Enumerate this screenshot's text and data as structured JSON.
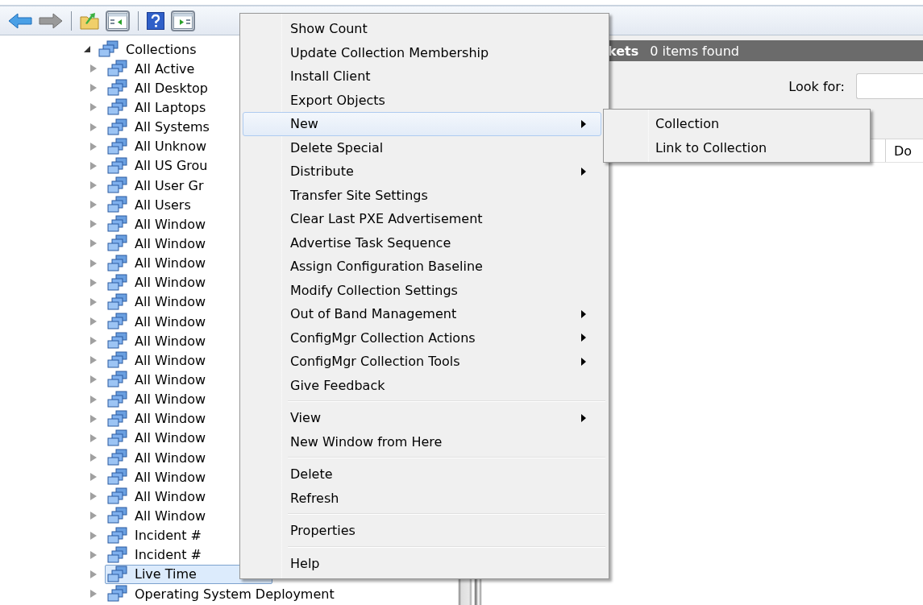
{
  "toolbar": [
    {
      "kind": "back"
    },
    {
      "kind": "forward"
    },
    {
      "kind": "separator"
    },
    {
      "kind": "up"
    },
    {
      "kind": "tree-toggle"
    },
    {
      "kind": "separator"
    },
    {
      "kind": "help"
    },
    {
      "kind": "action-toggle"
    }
  ],
  "tree": {
    "label": "Collections",
    "expanded": true,
    "children": [
      {
        "label": "All Active",
        "selected": false
      },
      {
        "label": "All Desktop",
        "selected": false
      },
      {
        "label": "All Laptops",
        "selected": false
      },
      {
        "label": "All Systems",
        "selected": false
      },
      {
        "label": "All Unknow",
        "selected": false
      },
      {
        "label": "All US Grou",
        "selected": false
      },
      {
        "label": "All User Gr",
        "selected": false
      },
      {
        "label": "All Users",
        "selected": false
      },
      {
        "label": "All Window",
        "selected": false
      },
      {
        "label": "All Window",
        "selected": false
      },
      {
        "label": "All Window",
        "selected": false
      },
      {
        "label": "All Window",
        "selected": false
      },
      {
        "label": "All Window",
        "selected": false
      },
      {
        "label": "All Window",
        "selected": false
      },
      {
        "label": "All Window",
        "selected": false
      },
      {
        "label": "All Window",
        "selected": false
      },
      {
        "label": "All Window",
        "selected": false
      },
      {
        "label": "All Window",
        "selected": false
      },
      {
        "label": "All Window",
        "selected": false
      },
      {
        "label": "All Window",
        "selected": false
      },
      {
        "label": "All Window",
        "selected": false
      },
      {
        "label": "All Window",
        "selected": false
      },
      {
        "label": "All Window",
        "selected": false
      },
      {
        "label": "All Window",
        "selected": false
      },
      {
        "label": "Incident #",
        "selected": false
      },
      {
        "label": "Incident #",
        "selected": false
      },
      {
        "label": "Live Time",
        "selected": true
      },
      {
        "label": "Operating System Deployment",
        "selected": false
      }
    ]
  },
  "results": {
    "title": "kets",
    "count": "0 items found",
    "search_label": "Look for:",
    "column_1": "Do"
  },
  "context_menu": [
    {
      "kind": "item",
      "label": "Show Count",
      "submenu": false,
      "selected": false
    },
    {
      "kind": "item",
      "label": "Update Collection Membership",
      "submenu": false,
      "selected": false
    },
    {
      "kind": "item",
      "label": "Install Client",
      "submenu": false,
      "selected": false
    },
    {
      "kind": "item",
      "label": "Export Objects",
      "submenu": false,
      "selected": false
    },
    {
      "kind": "item",
      "label": "New",
      "submenu": true,
      "selected": true
    },
    {
      "kind": "item",
      "label": "Delete Special",
      "submenu": false,
      "selected": false
    },
    {
      "kind": "item",
      "label": "Distribute",
      "submenu": true,
      "selected": false
    },
    {
      "kind": "item",
      "label": "Transfer Site Settings",
      "submenu": false,
      "selected": false
    },
    {
      "kind": "item",
      "label": "Clear Last PXE Advertisement",
      "submenu": false,
      "selected": false
    },
    {
      "kind": "item",
      "label": "Advertise Task Sequence",
      "submenu": false,
      "selected": false
    },
    {
      "kind": "item",
      "label": "Assign Configuration Baseline",
      "submenu": false,
      "selected": false
    },
    {
      "kind": "item",
      "label": "Modify Collection Settings",
      "submenu": false,
      "selected": false
    },
    {
      "kind": "item",
      "label": "Out of Band Management",
      "submenu": true,
      "selected": false
    },
    {
      "kind": "item",
      "label": "ConfigMgr Collection Actions",
      "submenu": true,
      "selected": false
    },
    {
      "kind": "item",
      "label": "ConfigMgr Collection Tools",
      "submenu": true,
      "selected": false
    },
    {
      "kind": "item",
      "label": "Give Feedback",
      "submenu": false,
      "selected": false
    },
    {
      "kind": "separator"
    },
    {
      "kind": "item",
      "label": "View",
      "submenu": true,
      "selected": false
    },
    {
      "kind": "item",
      "label": "New Window from Here",
      "submenu": false,
      "selected": false
    },
    {
      "kind": "separator"
    },
    {
      "kind": "item",
      "label": "Delete",
      "submenu": false,
      "selected": false
    },
    {
      "kind": "item",
      "label": "Refresh",
      "submenu": false,
      "selected": false
    },
    {
      "kind": "separator"
    },
    {
      "kind": "item",
      "label": "Properties",
      "submenu": false,
      "selected": false
    },
    {
      "kind": "separator"
    },
    {
      "kind": "item",
      "label": "Help",
      "submenu": false,
      "selected": false
    }
  ],
  "submenu": [
    {
      "label": "Collection"
    },
    {
      "label": "Link to Collection"
    }
  ]
}
